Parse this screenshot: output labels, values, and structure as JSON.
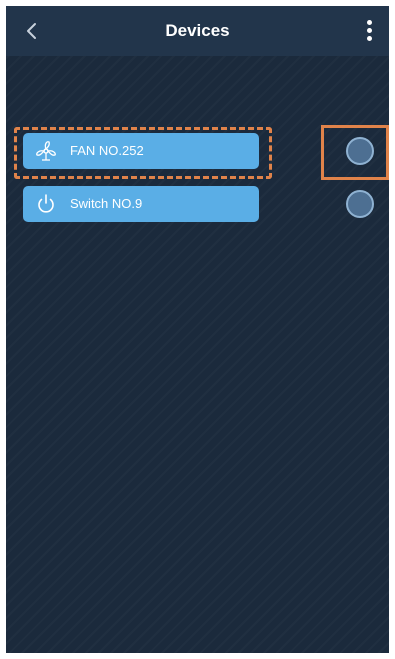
{
  "header": {
    "title": "Devices",
    "back_icon": "chevron-left-icon",
    "more_icon": "vertical-ellipsis-icon"
  },
  "devices": [
    {
      "label": "FAN NO.252",
      "icon": "fan-icon",
      "highlighted": true
    },
    {
      "label": "Switch NO.9",
      "icon": "power-icon",
      "highlighted": false
    }
  ],
  "colors": {
    "background": "#1b2a3c",
    "nav_bar": "#22354b",
    "device_button": "#5aaee6",
    "highlight": "#e0834a",
    "radio": "#4d6f92"
  }
}
